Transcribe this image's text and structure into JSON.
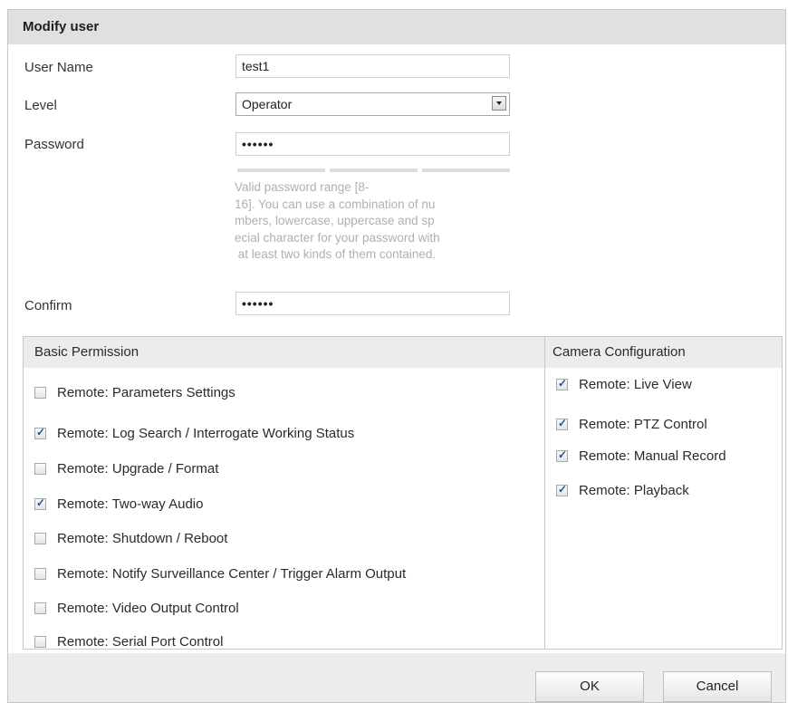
{
  "dialog": {
    "title": "Modify user"
  },
  "form": {
    "username_label": "User Name",
    "username_value": "test1",
    "level_label": "Level",
    "level_value": "Operator",
    "password_label": "Password",
    "password_value": "••••••",
    "password_hint": "Valid password range [8-\n16]. You can use a combination of nu\nmbers, lowercase, uppercase and sp\necial character for your password with\n at least two kinds of them contained.",
    "confirm_label": "Confirm",
    "confirm_value": "••••••"
  },
  "basic_permission": {
    "header": "Basic Permission",
    "items": [
      {
        "label": "Remote: Parameters Settings",
        "checked": false
      },
      {
        "label": "Remote: Log Search / Interrogate Working Status",
        "checked": true
      },
      {
        "label": "Remote: Upgrade / Format",
        "checked": false
      },
      {
        "label": "Remote: Two-way Audio",
        "checked": true
      },
      {
        "label": "Remote: Shutdown / Reboot",
        "checked": false
      },
      {
        "label": "Remote: Notify Surveillance Center / Trigger Alarm Output",
        "checked": false
      },
      {
        "label": "Remote: Video Output Control",
        "checked": false
      },
      {
        "label": "Remote: Serial Port Control",
        "checked": false
      }
    ]
  },
  "camera_configuration": {
    "header": "Camera Configuration",
    "items": [
      {
        "label": "Remote: Live View",
        "checked": true
      },
      {
        "label": "Remote: PTZ Control",
        "checked": true
      },
      {
        "label": "Remote: Manual Record",
        "checked": true
      },
      {
        "label": "Remote: Playback",
        "checked": true
      }
    ]
  },
  "buttons": {
    "ok": "OK",
    "cancel": "Cancel"
  },
  "colors": {
    "title_bg": "#e0e0e0",
    "footer_bg": "#ececec",
    "hint_text": "#b0b0b0",
    "check_mark": "#2b4d9a"
  }
}
